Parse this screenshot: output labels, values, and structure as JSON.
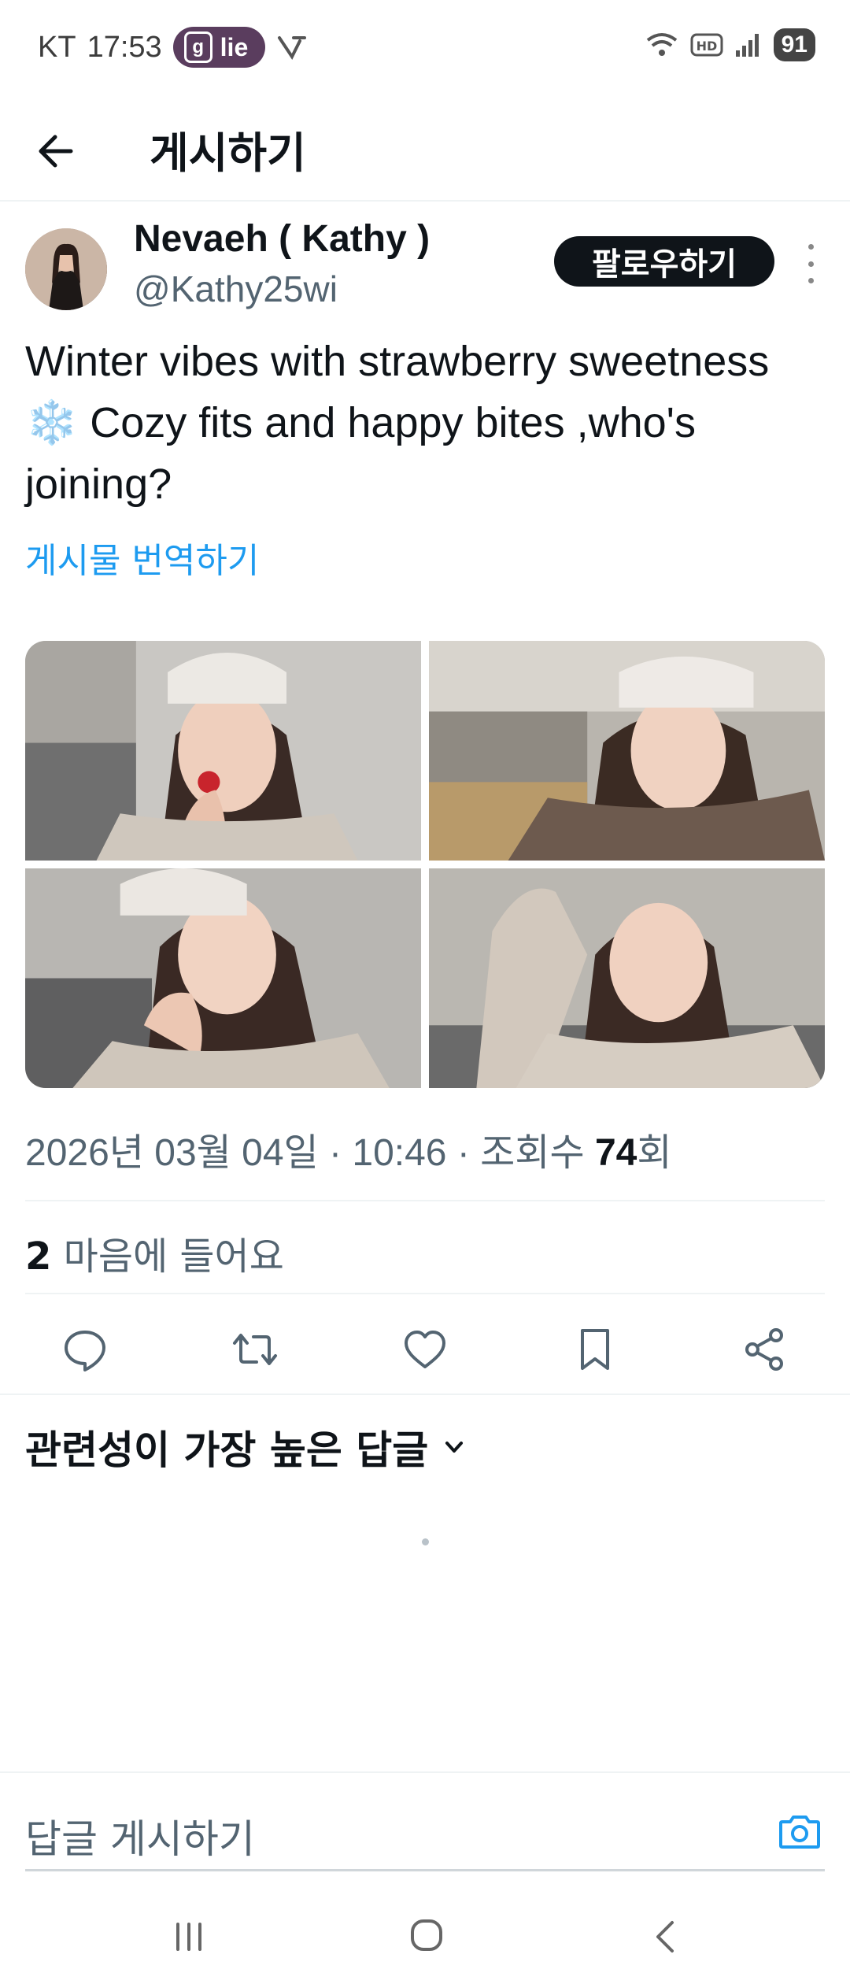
{
  "status_bar": {
    "carrier": "KT",
    "time": "17:53",
    "pill_icon_letter": "g",
    "pill_label": "lie",
    "battery": "91"
  },
  "header": {
    "title": "게시하기"
  },
  "author": {
    "name": "Nevaeh ( Kathy )",
    "handle": "@Kathy25wi",
    "follow_label": "팔로우하기"
  },
  "post": {
    "text": "Winter vibes with strawberry sweetness ❄️ Cozy fits and happy bites ,who's joining?",
    "translate_label": "게시물 번역하기",
    "date": "2026년 03월 04일 · 10:46 · 조회수 ",
    "views": "74",
    "views_suffix": "회",
    "likes_count": "2",
    "likes_label": " 마음에 들어요"
  },
  "replies": {
    "sort_label": "관련성이 가장 높은 답글"
  },
  "composer": {
    "placeholder": "답글 게시하기"
  },
  "colors": {
    "accent": "#1d9bf0",
    "text": "#0f1419",
    "muted": "#536471"
  }
}
